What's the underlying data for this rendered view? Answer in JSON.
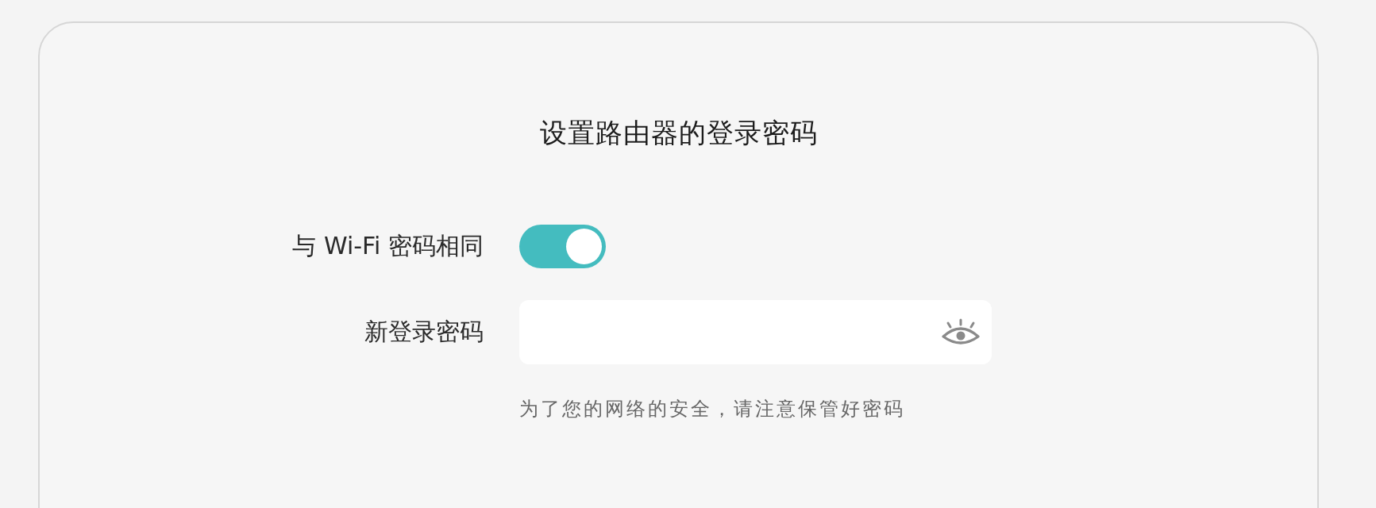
{
  "page": {
    "title": "设置路由器的登录密码"
  },
  "form": {
    "fields": [
      {
        "kind": "toggle",
        "label": "与 Wi-Fi 密码相同",
        "on": true
      },
      {
        "kind": "password",
        "label": "新登录密码"
      }
    ],
    "hint": "为了您的网络的安全，请注意保管好密码"
  }
}
